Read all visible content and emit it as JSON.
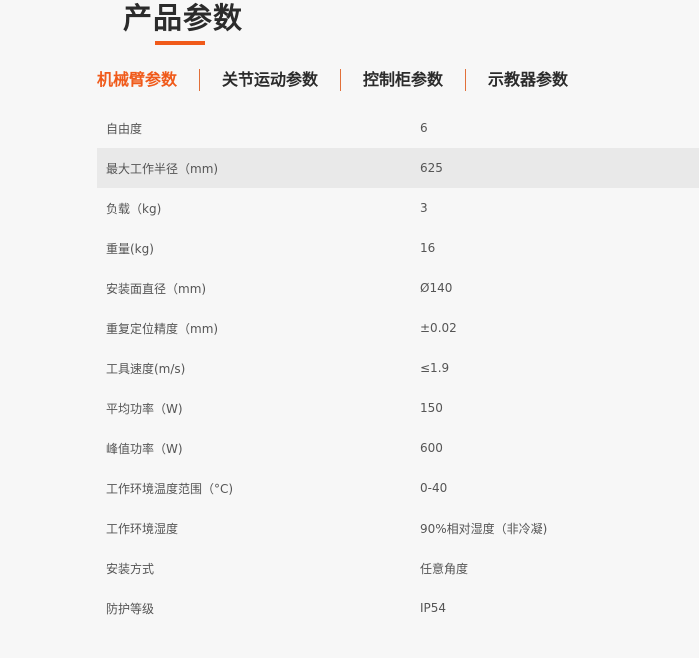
{
  "page": {
    "title": "产品参数"
  },
  "tabs": [
    {
      "label": "机械臂参数",
      "active": true
    },
    {
      "label": "关节运动参数",
      "active": false
    },
    {
      "label": "控制柜参数",
      "active": false
    },
    {
      "label": "示教器参数",
      "active": false
    }
  ],
  "params": [
    {
      "label": "自由度",
      "value": "6"
    },
    {
      "label": "最大工作半径（mm)",
      "value": "625"
    },
    {
      "label": "负载（kg)",
      "value": "3"
    },
    {
      "label": "重量(kg)",
      "value": "16"
    },
    {
      "label": "安装面直径（mm)",
      "value": "Ø140"
    },
    {
      "label": "重复定位精度（mm)",
      "value": "±0.02"
    },
    {
      "label": "工具速度(m/s)",
      "value": "≤1.9"
    },
    {
      "label": "平均功率（W)",
      "value": "150"
    },
    {
      "label": "峰值功率（W)",
      "value": "600"
    },
    {
      "label": "工作环境温度范围（°C)",
      "value": "0-40"
    },
    {
      "label": "工作环境湿度",
      "value": "90%相对湿度（非冷凝)"
    },
    {
      "label": "安装方式",
      "value": "任意角度"
    },
    {
      "label": "防护等级",
      "value": "IP54"
    }
  ],
  "colors": {
    "accent": "#f05a1a",
    "shaded_row": "#e9e9e9",
    "background": "#f7f7f7"
  }
}
